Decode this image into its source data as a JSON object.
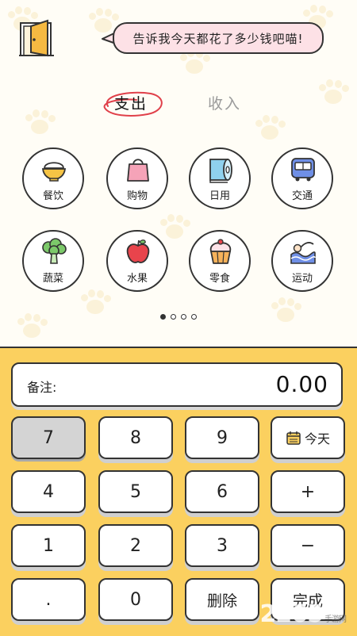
{
  "header": {
    "prompt": "告诉我今天都花了多少钱吧喵!"
  },
  "tabs": {
    "expense": "支出",
    "income": "收入",
    "active": "expense"
  },
  "categories": [
    {
      "label": "餐饮",
      "icon": "rice-bowl-icon"
    },
    {
      "label": "购物",
      "icon": "shopping-bag-icon"
    },
    {
      "label": "日用",
      "icon": "toilet-paper-icon"
    },
    {
      "label": "交通",
      "icon": "bus-icon"
    },
    {
      "label": "蔬菜",
      "icon": "broccoli-icon"
    },
    {
      "label": "水果",
      "icon": "apple-icon"
    },
    {
      "label": "零食",
      "icon": "cupcake-icon"
    },
    {
      "label": "运动",
      "icon": "swimming-icon"
    }
  ],
  "pagination": {
    "total": 4,
    "current": 1
  },
  "note": {
    "label": "备注:",
    "value": "",
    "amount": "0.00"
  },
  "keypad": {
    "k7": "7",
    "k8": "8",
    "k9": "9",
    "today": "今天",
    "k4": "4",
    "k5": "5",
    "k6": "6",
    "plus": "+",
    "k1": "1",
    "k2": "2",
    "k3": "3",
    "minus": "−",
    "dot": ".",
    "k0": "0",
    "delete": "删除",
    "done": "完成",
    "pressed_key": "7"
  },
  "watermark": {
    "number": "2265",
    "site": "手游网"
  },
  "colors": {
    "keypad_bg": "#fbd05f",
    "bubble_bg": "#fde1e6",
    "accent_red": "#e0404a"
  }
}
